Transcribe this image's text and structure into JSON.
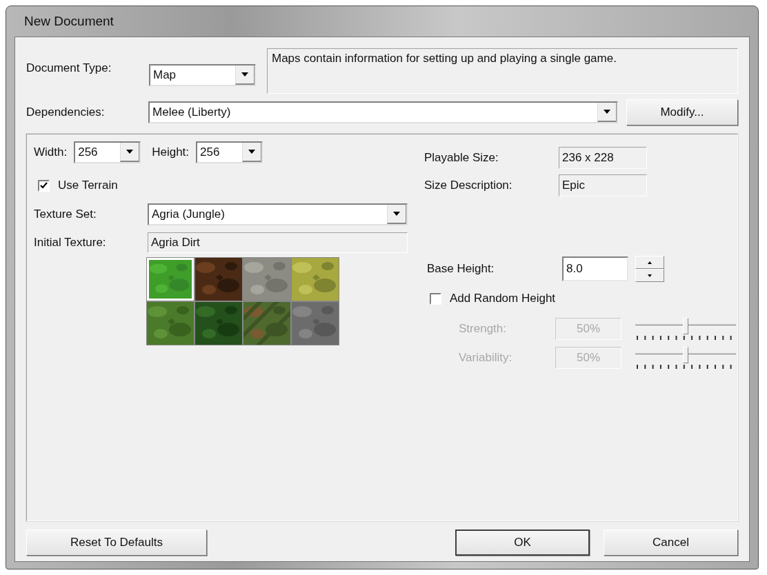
{
  "window": {
    "title": "New Document"
  },
  "document_type": {
    "label": "Document Type:",
    "value": "Map"
  },
  "description": "Maps contain information for setting up and playing a single game.",
  "dependencies": {
    "label": "Dependencies:",
    "value": "Melee (Liberty)",
    "button": "Modify..."
  },
  "width": {
    "label": "Width:",
    "value": "256"
  },
  "height": {
    "label": "Height:",
    "value": "256"
  },
  "use_terrain": {
    "label": "Use Terrain",
    "checked": true
  },
  "texture_set": {
    "label": "Texture Set:",
    "value": "Agria (Jungle)"
  },
  "initial_texture": {
    "label": "Initial Texture:",
    "value": "Agria Dirt"
  },
  "textures": [
    {
      "kind": "picture",
      "selected": true
    },
    {
      "kind": "picture",
      "selected": false
    },
    {
      "kind": "picture",
      "selected": false
    },
    {
      "kind": "picture",
      "selected": false
    },
    {
      "kind": "picture",
      "selected": false
    },
    {
      "kind": "picture",
      "selected": false
    },
    {
      "kind": "picture",
      "selected": false
    },
    {
      "kind": "picture",
      "selected": false
    }
  ],
  "playable_size": {
    "label": "Playable Size:",
    "value": "236 x 228"
  },
  "size_description": {
    "label": "Size Description:",
    "value": "Epic"
  },
  "base_height": {
    "label": "Base Height:",
    "value": "8.0"
  },
  "add_random_height": {
    "label": "Add Random Height",
    "checked": false
  },
  "random_params": [
    {
      "label": "Strength:",
      "value": "50%",
      "level": 0.5,
      "disabled": true
    },
    {
      "label": "Variability:",
      "value": "50%",
      "level": 0.5,
      "disabled": true
    }
  ],
  "footer": {
    "reset": "Reset To Defaults",
    "ok": "OK",
    "cancel": "Cancel"
  }
}
